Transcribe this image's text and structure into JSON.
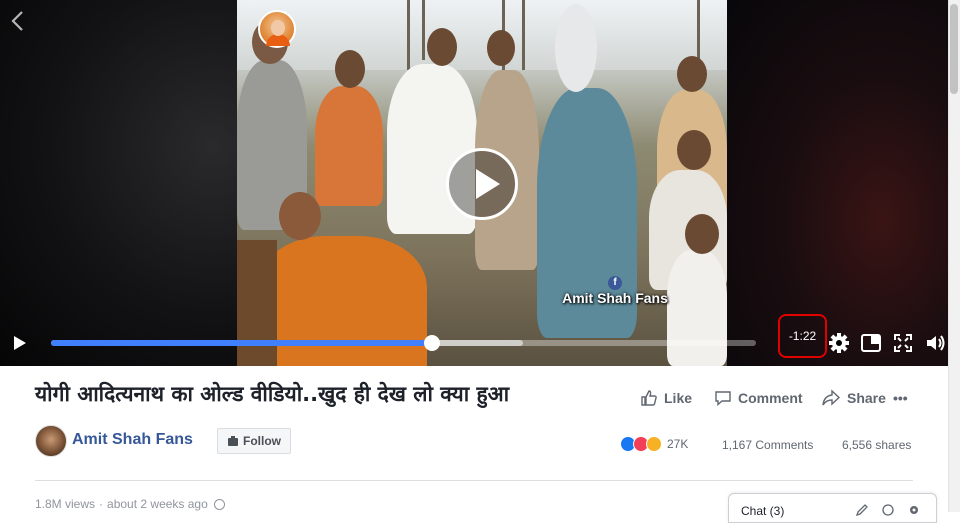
{
  "video": {
    "watermark_text": "Amit Shah Fans",
    "time_remaining": "-1:22",
    "progress_fraction": 0.54,
    "buffered_fraction": 0.67
  },
  "post": {
    "title": "योगी आदित्यनाथ का ओल्ड वीडियो..खुद ही देख लो क्या हुआ",
    "actions": {
      "like": "Like",
      "comment": "Comment",
      "share": "Share",
      "more": "•••"
    },
    "author": {
      "name": "Amit Shah Fans",
      "follow_label": "Follow"
    },
    "reactions": {
      "count": "27K",
      "types": [
        "like",
        "love",
        "wow"
      ]
    },
    "comments": "1,167 Comments",
    "shares": "6,556 shares",
    "views": "1.8M views",
    "posted": "about 2 weeks ago"
  },
  "chat": {
    "label": "Chat (3)"
  },
  "colors": {
    "accent": "#4080ff",
    "link": "#365899",
    "highlight": "#e00000"
  },
  "icons": [
    "back-arrow-icon",
    "play-icon",
    "settings-gear-icon",
    "picture-in-picture-icon",
    "fullscreen-icon",
    "volume-icon",
    "like-icon",
    "comment-icon",
    "share-icon",
    "globe-icon",
    "facebook-icon"
  ]
}
